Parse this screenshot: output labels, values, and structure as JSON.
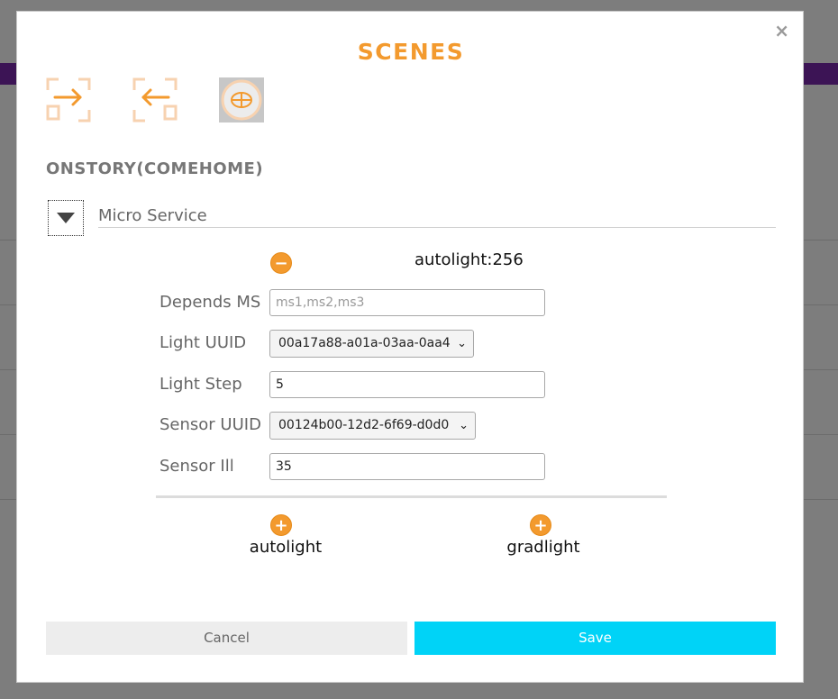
{
  "modal": {
    "close_label": "×",
    "title": "SCENES",
    "toolbar_icons": [
      "enter-icon",
      "exit-icon",
      "scene-globe-icon"
    ],
    "scene_name": "ONSTORY(COMEHOME)",
    "section_label": "Micro Service"
  },
  "micro_service": {
    "header": "autolight:256",
    "remove_label": "−",
    "fields": {
      "depends_label": "Depends MS",
      "depends_placeholder": "ms1,ms2,ms3",
      "depends_value": "",
      "light_uuid_label": "Light UUID",
      "light_uuid_value": "00a17a88-a01a-03aa-0aa4",
      "light_step_label": "Light Step",
      "light_step_value": "5",
      "sensor_uuid_label": "Sensor UUID",
      "sensor_uuid_value": "00124b00-12d2-6f69-d0d0",
      "sensor_ill_label": "Sensor Ill",
      "sensor_ill_value": "35"
    }
  },
  "add_services": [
    {
      "label": "autolight",
      "button": "+"
    },
    {
      "label": "gradlight",
      "button": "+"
    }
  ],
  "footer": {
    "cancel_label": "Cancel",
    "save_label": "Save"
  },
  "colors": {
    "accent": "#f39a2e",
    "save": "#00d3f7",
    "overlay": "#7d7d7d",
    "header_bar": "#3c1455"
  }
}
